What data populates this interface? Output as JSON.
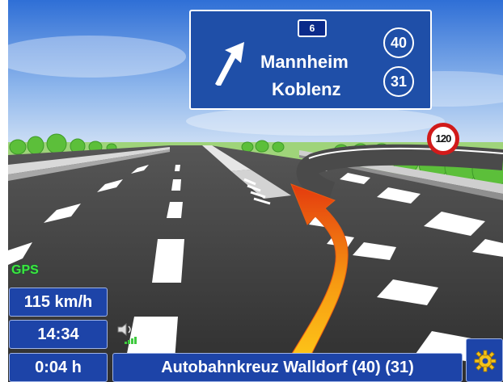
{
  "sign": {
    "route_number": "6",
    "destinations": [
      "Mannheim",
      "Koblenz"
    ],
    "exit_numbers": [
      "40",
      "31"
    ],
    "arrow_icon": "arrow-up-right-icon"
  },
  "speed_limit": "120",
  "gps_label": "GPS",
  "status": {
    "speed": "115 km/h",
    "time": "14:34",
    "remaining": "0:04 h"
  },
  "street": "Autobahnkreuz Walldorf (40) (31)",
  "icons": {
    "volume": "volume-icon",
    "signal": "signal-strength-icon",
    "settings": "gear-icon"
  },
  "colors": {
    "sign_blue": "#1f4fa8",
    "panel_blue": "#1d44a8",
    "route_orange": "#f07a10",
    "limit_red": "#d11a1a",
    "gps_green": "#3de83d"
  }
}
